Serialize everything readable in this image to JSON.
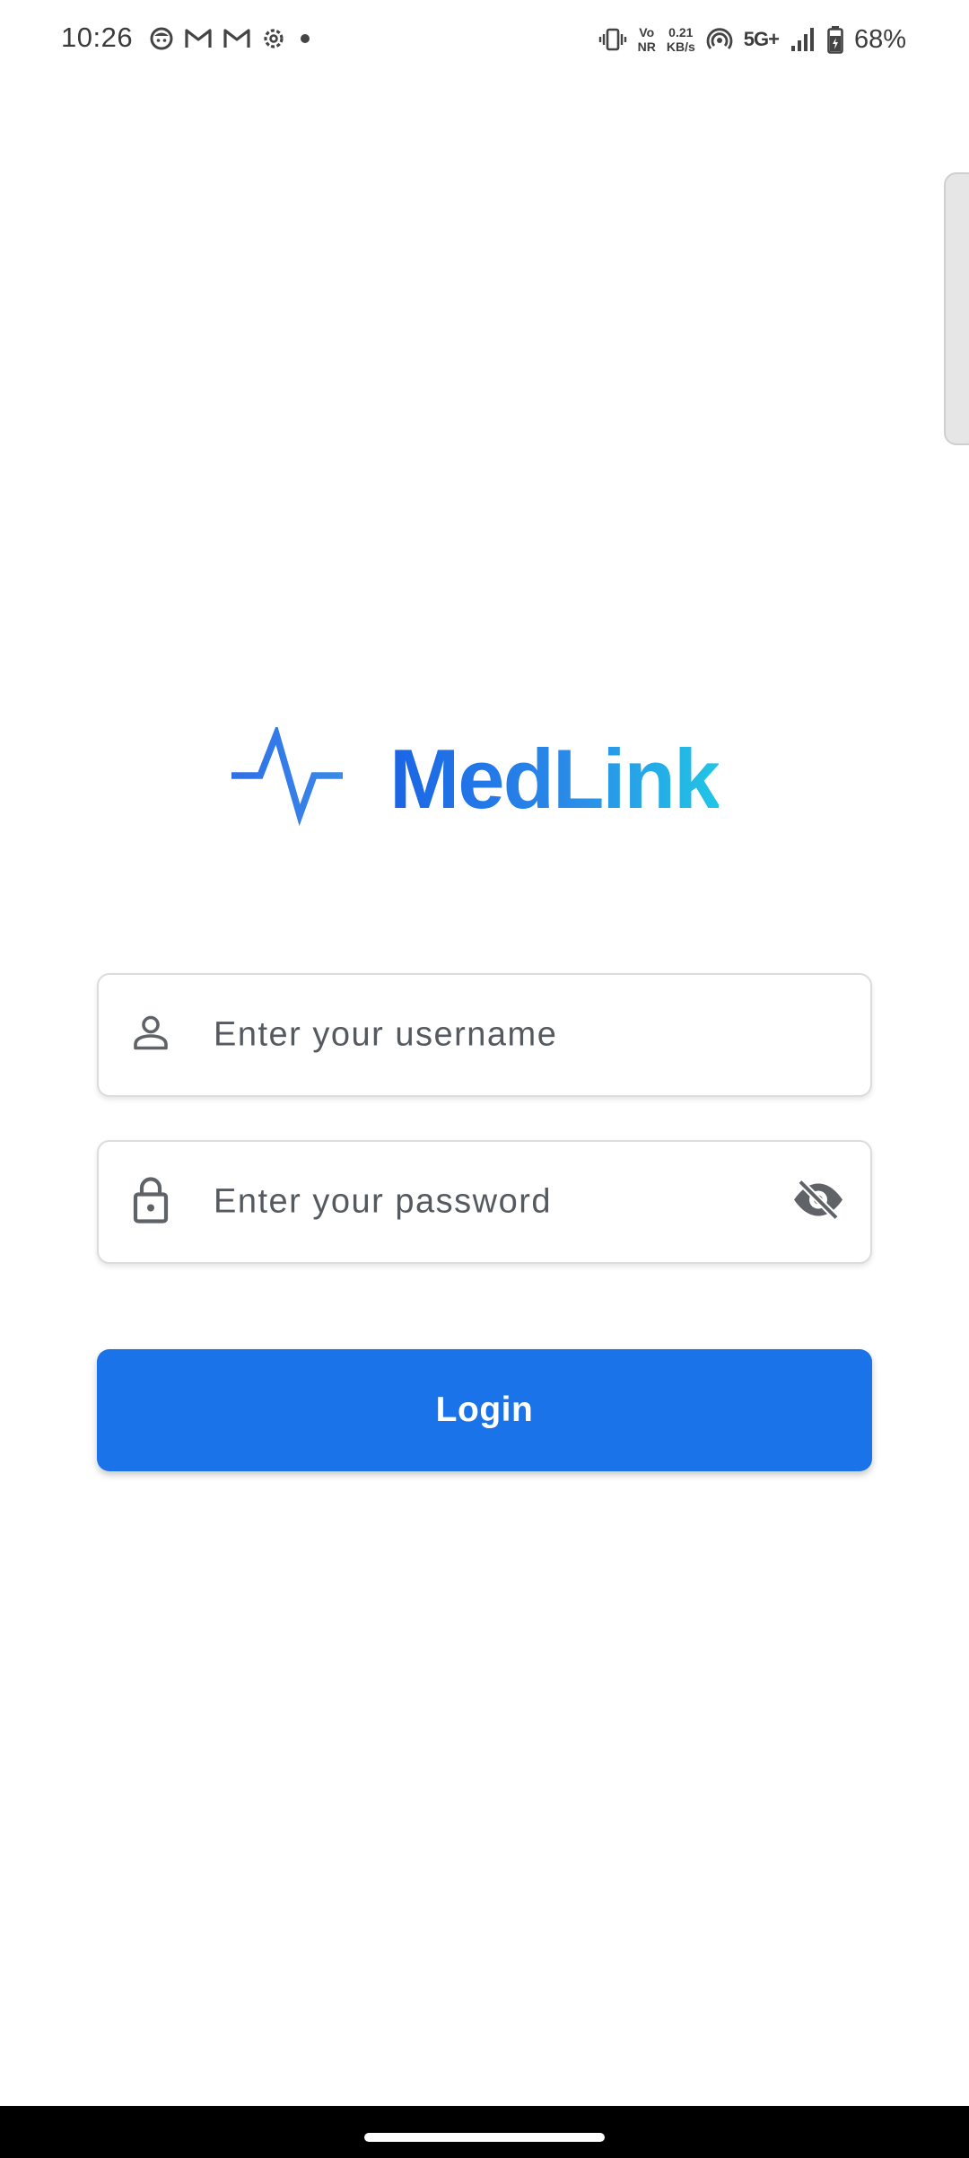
{
  "status_bar": {
    "time": "10:26",
    "left_icons": [
      "face-icon",
      "gmail-icon",
      "gmail-icon",
      "settings-icon",
      "dot-icon"
    ],
    "vonr_top": "Vo",
    "vonr_bottom": "NR",
    "speed_value": "0.21",
    "speed_unit": "KB/s",
    "network": "5G+",
    "battery": "68%"
  },
  "logo": {
    "icon": "pulse-icon",
    "text": "MedLink",
    "gradient_start": "#1b64e6",
    "gradient_end": "#21c5e6"
  },
  "login_form": {
    "username": {
      "icon": "person-icon",
      "placeholder": "Enter your username",
      "value": ""
    },
    "password": {
      "icon": "lock-icon",
      "placeholder": "Enter your password",
      "value": "",
      "toggle_icon": "visibility-off-icon"
    },
    "submit_label": "Login",
    "accent_color": "#1a73e8"
  }
}
